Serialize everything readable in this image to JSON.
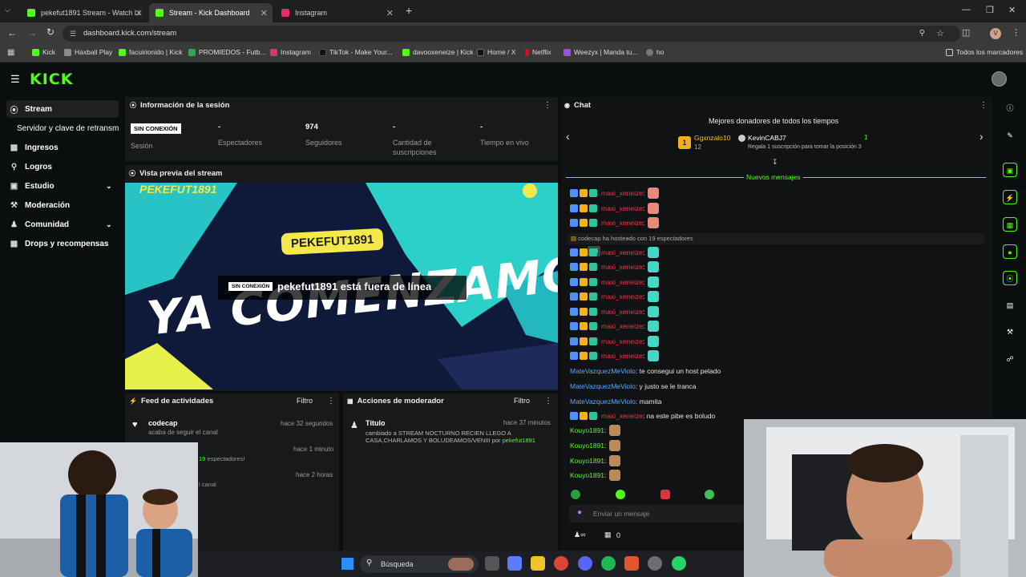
{
  "browser": {
    "tabs": [
      {
        "title": "pekefut1891 Stream - Watch Li",
        "color": "#53fc18"
      },
      {
        "title": "Stream - Kick Dashboard",
        "color": "#53fc18"
      },
      {
        "title": "Instagram",
        "color": "#e1306c"
      }
    ],
    "url": "dashboard.kick.com/stream",
    "avatar_letter": "V",
    "bookmarks": [
      "Kick",
      "Haxball Play",
      "facuirionido | Kick",
      "PROMIEDOS - Futb...",
      "Instagram",
      "TikTok - Make Your...",
      "davooxeneize | Kick",
      "Home / X",
      "Netflix",
      "Weezyx | Manda tu...",
      "ho"
    ],
    "all_bookmarks": "Todos los marcadores"
  },
  "brand": {
    "logo": "KICK",
    "accent": "#53fc18"
  },
  "sidebar": {
    "items": [
      {
        "label": "Stream",
        "icon": "broadcast-icon"
      },
      {
        "label": "Servidor y clave de retransm",
        "icon": ""
      },
      {
        "label": "Ingresos",
        "icon": "chart-icon"
      },
      {
        "label": "Logros",
        "icon": "trophy-icon"
      },
      {
        "label": "Estudio",
        "icon": "studio-icon"
      },
      {
        "label": "Moderación",
        "icon": "wrench-icon"
      },
      {
        "label": "Comunidad",
        "icon": "people-icon"
      },
      {
        "label": "Drops y recompensas",
        "icon": "gift-icon"
      }
    ]
  },
  "session": {
    "title": "Información de la sesión",
    "status_badge": "SIN CONEXIÓN",
    "session_label": "Sesión",
    "stats": [
      {
        "value": "-",
        "label": "Espectadores"
      },
      {
        "value": "974",
        "label": "Seguidores"
      },
      {
        "value": "-",
        "label": "Cantidad de suscripciones"
      },
      {
        "value": "-",
        "label": "Tiempo en vivo"
      }
    ]
  },
  "preview": {
    "title": "Vista previa del stream",
    "banner_channel": "PEKEFUT1891",
    "banner_top": "PEKEFUT1891",
    "banner_big": "YA COMENZAMOS",
    "offline_badge": "SIN CONEXIÓN",
    "offline_text": "pekefut1891 está fuera de línea"
  },
  "activity": {
    "title": "Feed de actividades",
    "filter": "Filtro",
    "items": [
      {
        "user": "codecap",
        "desc": "acaba de seguir el canal",
        "time": "hace 32 segundos"
      },
      {
        "user": "",
        "desc": "19 espectadores!",
        "time": "hace 1 minuto"
      },
      {
        "user": "",
        "desc": "l canal",
        "time": "hace 2 horas"
      }
    ]
  },
  "mod": {
    "title": "Acciones de moderador",
    "filter": "Filtro",
    "item_title": "Título",
    "item_time": "hace 37 minutos",
    "item_desc": "cambiado a STREAM NOCTURNO RECIEN LLEGO A CASA,CHARLAMOS Y BOLUDEAMOS/VENIII por",
    "item_user": "pekefut1891"
  },
  "chat": {
    "title": "Chat",
    "donors_title": "Mejores donadores de todos los tiempos",
    "donor1": {
      "name": "Ggxnzalo10",
      "count": "12"
    },
    "donor2": {
      "name": "KevinCABJ7",
      "count": "1",
      "note": "Regala 1 suscripción para tomar la posición 3"
    },
    "rank_badge": "1",
    "new_messages": "Nuevos mensajes",
    "host_msg": "codecap ha hosteado con 19 espectadores",
    "messages": [
      {
        "user": "maxi_xeneize",
        "text": ":",
        "type": "red"
      },
      {
        "user": "maxi_xeneize",
        "text": ":",
        "type": "red"
      },
      {
        "user": "maxi_xeneize",
        "text": ":",
        "type": "red"
      },
      {
        "user": "maxi_xeneize",
        "text": ":",
        "type": "red"
      },
      {
        "user": "maxi_xeneize",
        "text": ":",
        "type": "red"
      },
      {
        "user": "maxi_xeneize",
        "text": ":",
        "type": "red"
      },
      {
        "user": "maxi_xeneize",
        "text": ":",
        "type": "red"
      },
      {
        "user": "maxi_xeneize",
        "text": ":",
        "type": "red"
      },
      {
        "user": "maxi_xeneize",
        "text": ":",
        "type": "red"
      },
      {
        "user": "maxi_xeneize",
        "text": ":",
        "type": "red"
      },
      {
        "user": "maxi_xeneize",
        "text": ":",
        "type": "red"
      },
      {
        "user": "MateVazquezMeViolo",
        "text": ": te consegui un host pelado",
        "type": "blue"
      },
      {
        "user": "MateVazquezMeViolo",
        "text": ": y justo se le tranca",
        "type": "blue"
      },
      {
        "user": "MateVazquezMeViolo",
        "text": ": mamita",
        "type": "blue"
      },
      {
        "user": "maxi_xeneize",
        "text": ": na este pibe es boludo",
        "type": "red"
      },
      {
        "user": "Kouyo1891",
        "text": ":",
        "type": "green"
      },
      {
        "user": "Kouyo1891",
        "text": ":",
        "type": "green"
      },
      {
        "user": "Kouyo1891",
        "text": ":",
        "type": "green"
      },
      {
        "user": "Kouyo1891",
        "text": ":",
        "type": "green"
      }
    ],
    "tooltip": "OG",
    "input_placeholder": "Enviar un mensaje",
    "bottom_count": "0"
  },
  "taskbar": {
    "search": "Búsqueda"
  }
}
